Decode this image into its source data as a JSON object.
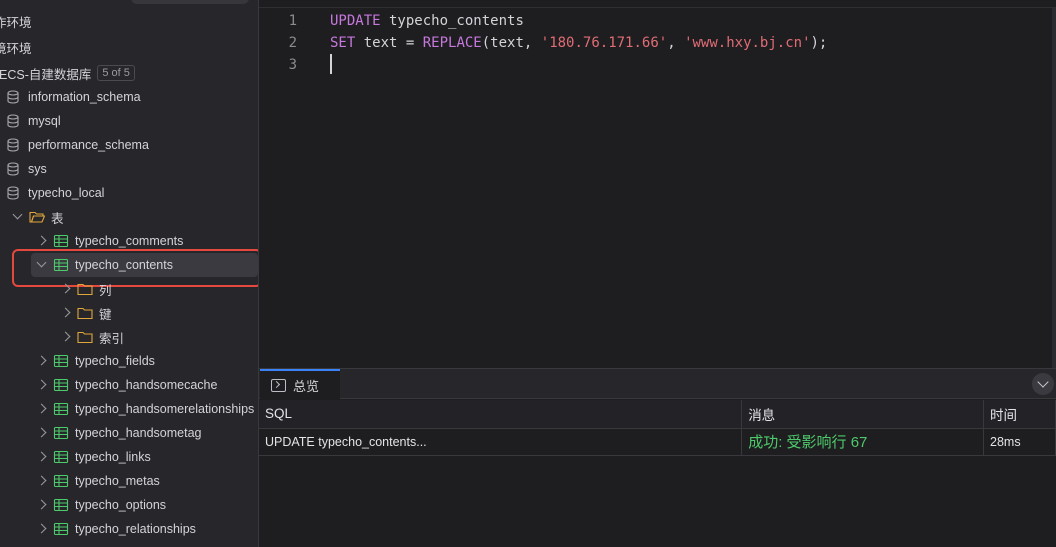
{
  "sidebar": {
    "groups": [
      "一环境",
      "一环境"
    ],
    "group_labels": [
      "作环境",
      "境环境"
    ],
    "connection": {
      "label": "ECS-自建数据库",
      "badge": "5 of 5"
    },
    "databases": [
      "information_schema",
      "mysql",
      "performance_schema",
      "sys",
      "typecho_local"
    ],
    "tables_folder": "表",
    "tables_top": [
      "typecho_comments",
      "typecho_contents"
    ],
    "subfolders": [
      "列",
      "键",
      "索引"
    ],
    "tables_rest": [
      "typecho_fields",
      "typecho_handsomecache",
      "typecho_handsomerelationships",
      "typecho_handsometag",
      "typecho_links",
      "typecho_metas",
      "typecho_options",
      "typecho_relationships"
    ]
  },
  "editor": {
    "line_numbers": [
      "1",
      "2",
      "3"
    ],
    "line1": {
      "kw": "UPDATE",
      "rest": " typecho_contents"
    },
    "line2": {
      "kw": "SET",
      "a": " text = ",
      "fn": "REPLACE",
      "b": "(text, ",
      "s1": "'180.76.171.66'",
      "c": ", ",
      "s2": "'www.hxy.bj.cn'",
      "d": ");"
    }
  },
  "results": {
    "tab_label": "总览",
    "columns": [
      "SQL",
      "消息",
      "时间"
    ],
    "rows": [
      {
        "sql": "UPDATE typecho_contents...",
        "message": "成功: 受影响行 67",
        "time": "28ms"
      }
    ]
  },
  "colors": {
    "success": "#4ec96b",
    "keyword": "#c678dd",
    "string": "#e06c75",
    "highlight": "#e5483d"
  }
}
